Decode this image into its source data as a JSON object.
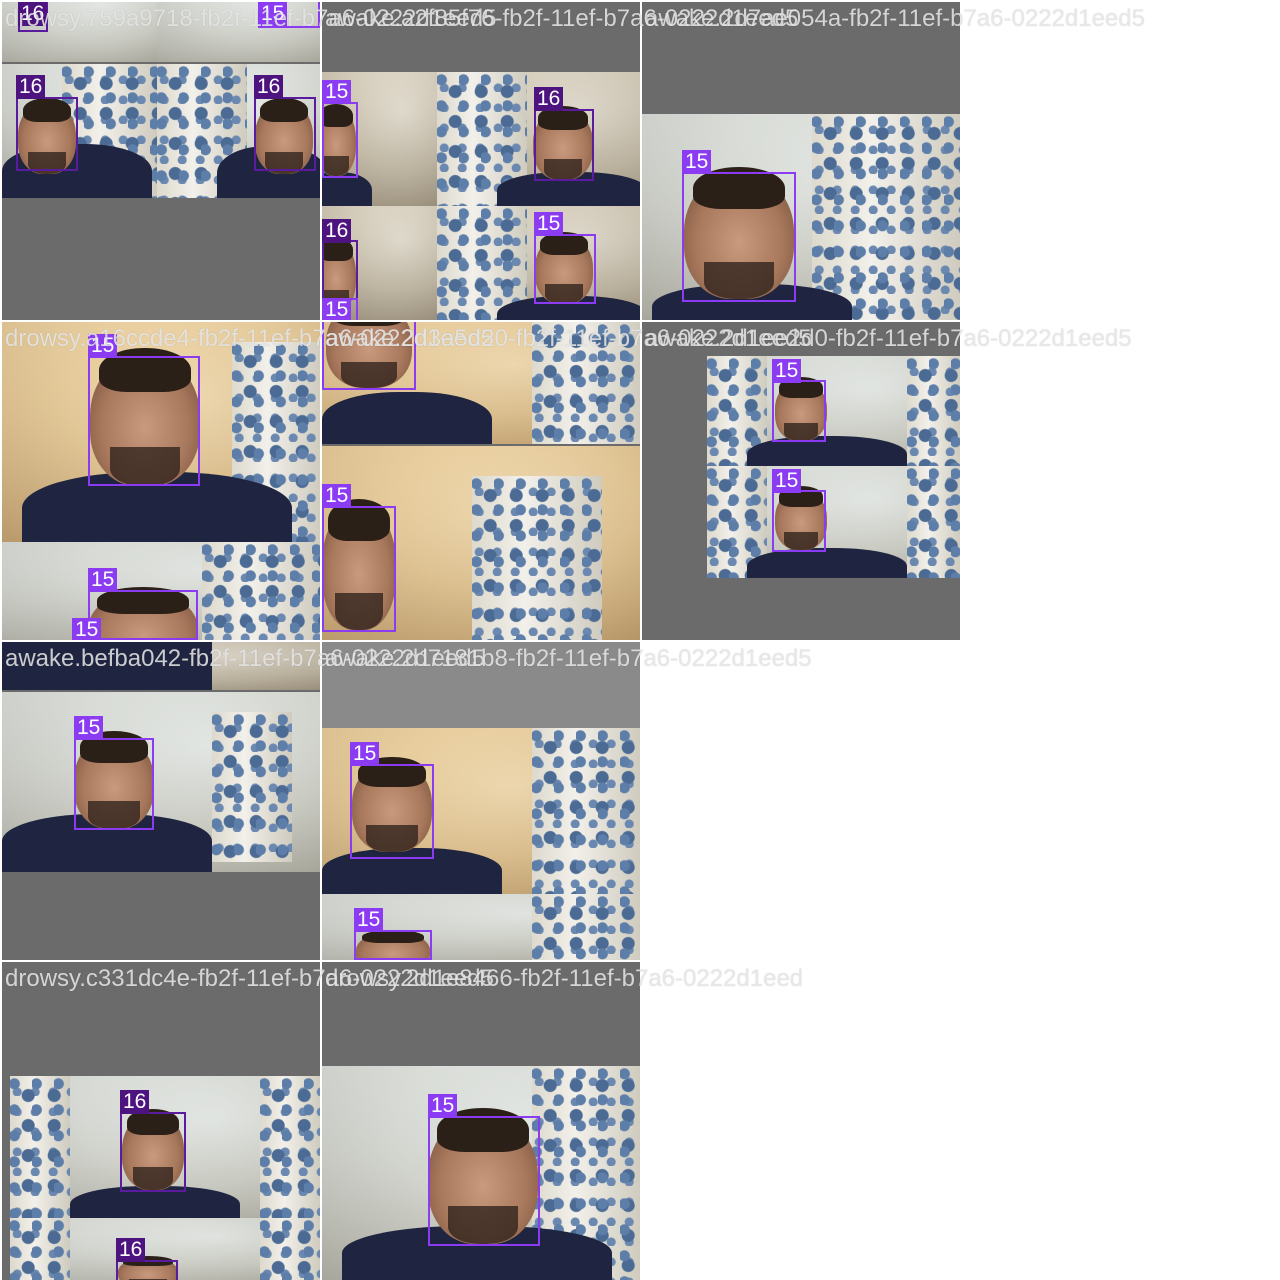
{
  "grid": {
    "captions": [
      "drowsy.759a9718-fb2f-11ef-b7a6-0222d1eed5",
      "awake.a2f85f76-fb2f-11ef-b7a6-0222d1eed5",
      "awake.2d7ae054a-fb2f-11ef-b7a6-0222d1eed5",
      "drowsy.a16ccde4-fb2f-11ef-b7a6-0222d1eed5",
      "awake.2d3a5d20-fb2f-11ef-b7a6-0222d1eed5",
      "awake.2d1ee2d0-fb2f-11ef-b7a6-0222d1eed5",
      "awake.befba042-fb2f-11ef-b7a6-0222d1eed5",
      "awake.2d7181b8-fb2f-11ef-b7a6-0222d1eed5",
      "drowsy.c331dc4e-fb2f-11ef-b7a6-0222d1eed5",
      "drowsy.2d1e8466-fb2f-11ef-b7a6-0222d1eed"
    ],
    "box_labels": {
      "t1": [
        "16",
        "15",
        "16",
        "16"
      ],
      "t2": [
        "15",
        "16",
        "16",
        "15",
        "15"
      ],
      "t3": [
        "15"
      ],
      "t4": [
        "15",
        "15",
        "15"
      ],
      "t5": [
        "15"
      ],
      "t6": [
        "15",
        "15"
      ],
      "t7": [
        "15"
      ],
      "t8": [
        "15",
        "15"
      ],
      "t9": [
        "16",
        "16"
      ],
      "t10": [
        "15"
      ]
    }
  },
  "colors": {
    "box_class_15": "#8b3cf2",
    "box_class_16": "#5a1b9e",
    "tile_padding_gray": "#6b6b6b"
  }
}
